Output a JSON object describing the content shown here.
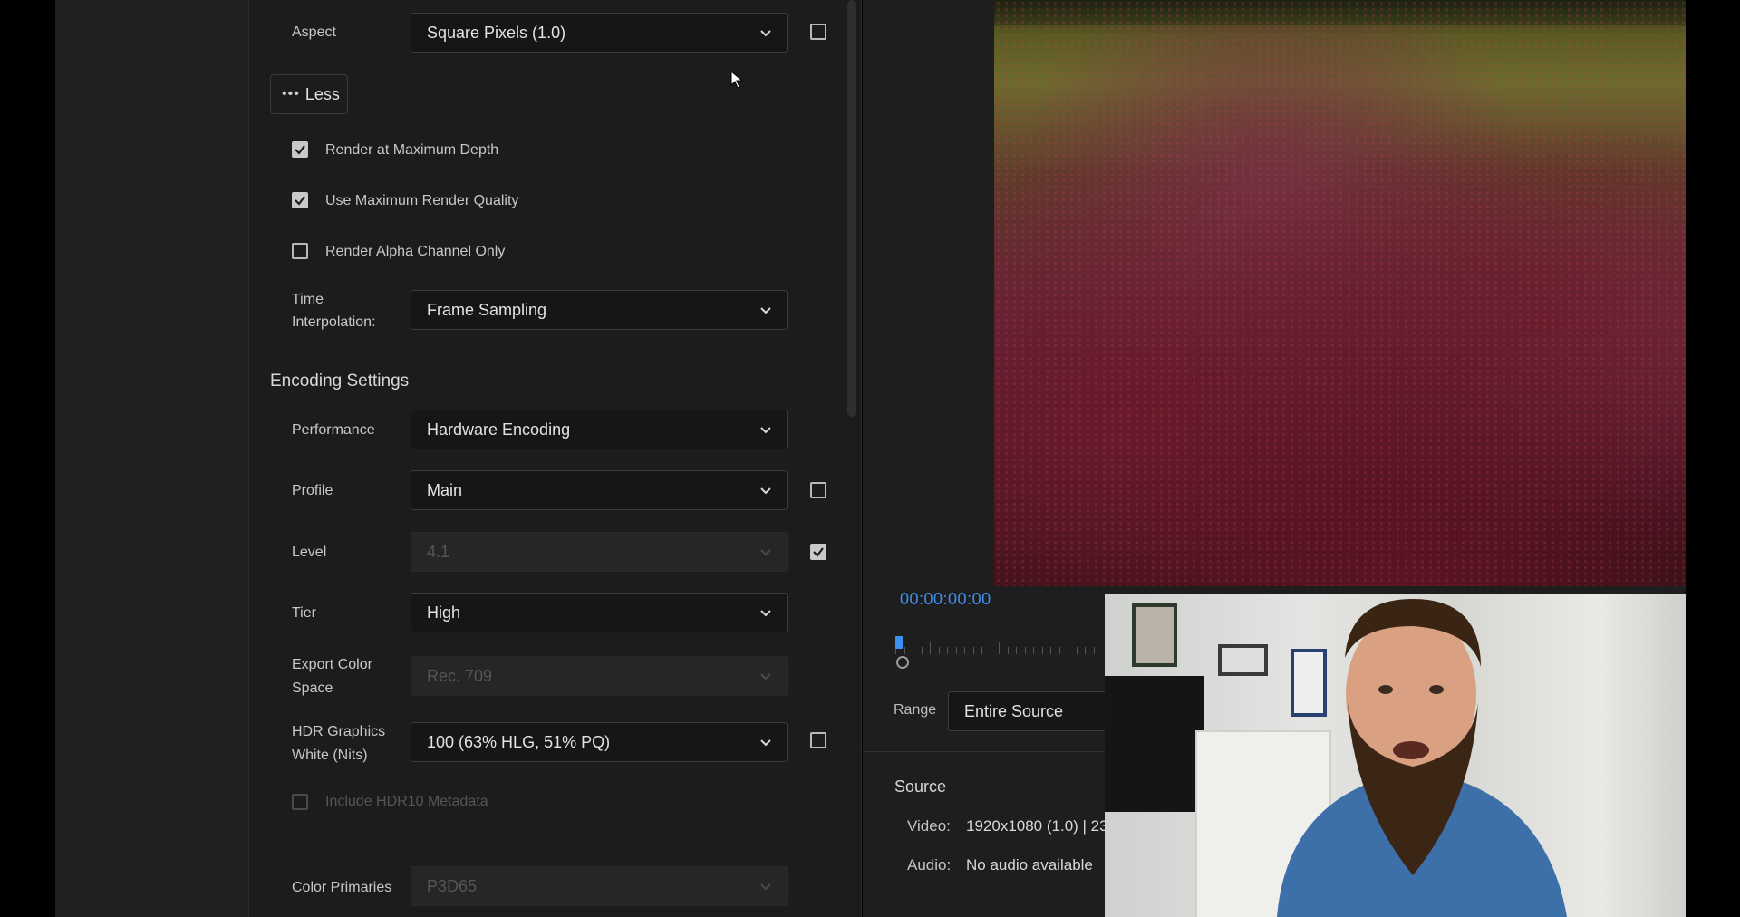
{
  "settings": {
    "aspect": {
      "label": "Aspect",
      "value": "Square Pixels (1.0)"
    },
    "less_button": {
      "dots": "•••",
      "label": "Less"
    },
    "checkboxes": [
      {
        "label": "Render at Maximum Depth",
        "checked": true
      },
      {
        "label": "Use Maximum Render Quality",
        "checked": true
      },
      {
        "label": "Render Alpha Channel Only",
        "checked": false
      }
    ],
    "time_interpolation": {
      "label_line1": "Time",
      "label_line2": "Interpolation:",
      "value": "Frame Sampling"
    },
    "encoding_title": "Encoding Settings",
    "performance": {
      "label": "Performance",
      "value": "Hardware Encoding"
    },
    "profile": {
      "label": "Profile",
      "value": "Main"
    },
    "level": {
      "label": "Level",
      "value": "4.1"
    },
    "tier": {
      "label": "Tier",
      "value": "High"
    },
    "export_color_space": {
      "label_line1": "Export Color",
      "label_line2": "Space",
      "value": "Rec. 709"
    },
    "hdr_graphics": {
      "label_line1": "HDR Graphics",
      "label_line2": "White (Nits)",
      "value": "100 (63% HLG, 51% PQ)"
    },
    "include_hdr10": {
      "label": "Include HDR10 Metadata",
      "checked": false
    },
    "color_primaries": {
      "label": "Color Primaries",
      "value": "P3D65"
    }
  },
  "preview": {
    "timecode": "00:00:00:00",
    "range_label": "Range",
    "range_value": "Entire Source",
    "source_title": "Source",
    "video_label": "Video:",
    "video_value": "1920x1080 (1.0)  |  23",
    "audio_label": "Audio:",
    "audio_value": "No audio available"
  },
  "colors": {
    "accent_blue": "#3d8ff0",
    "panel_bg": "#1c1c1c"
  }
}
